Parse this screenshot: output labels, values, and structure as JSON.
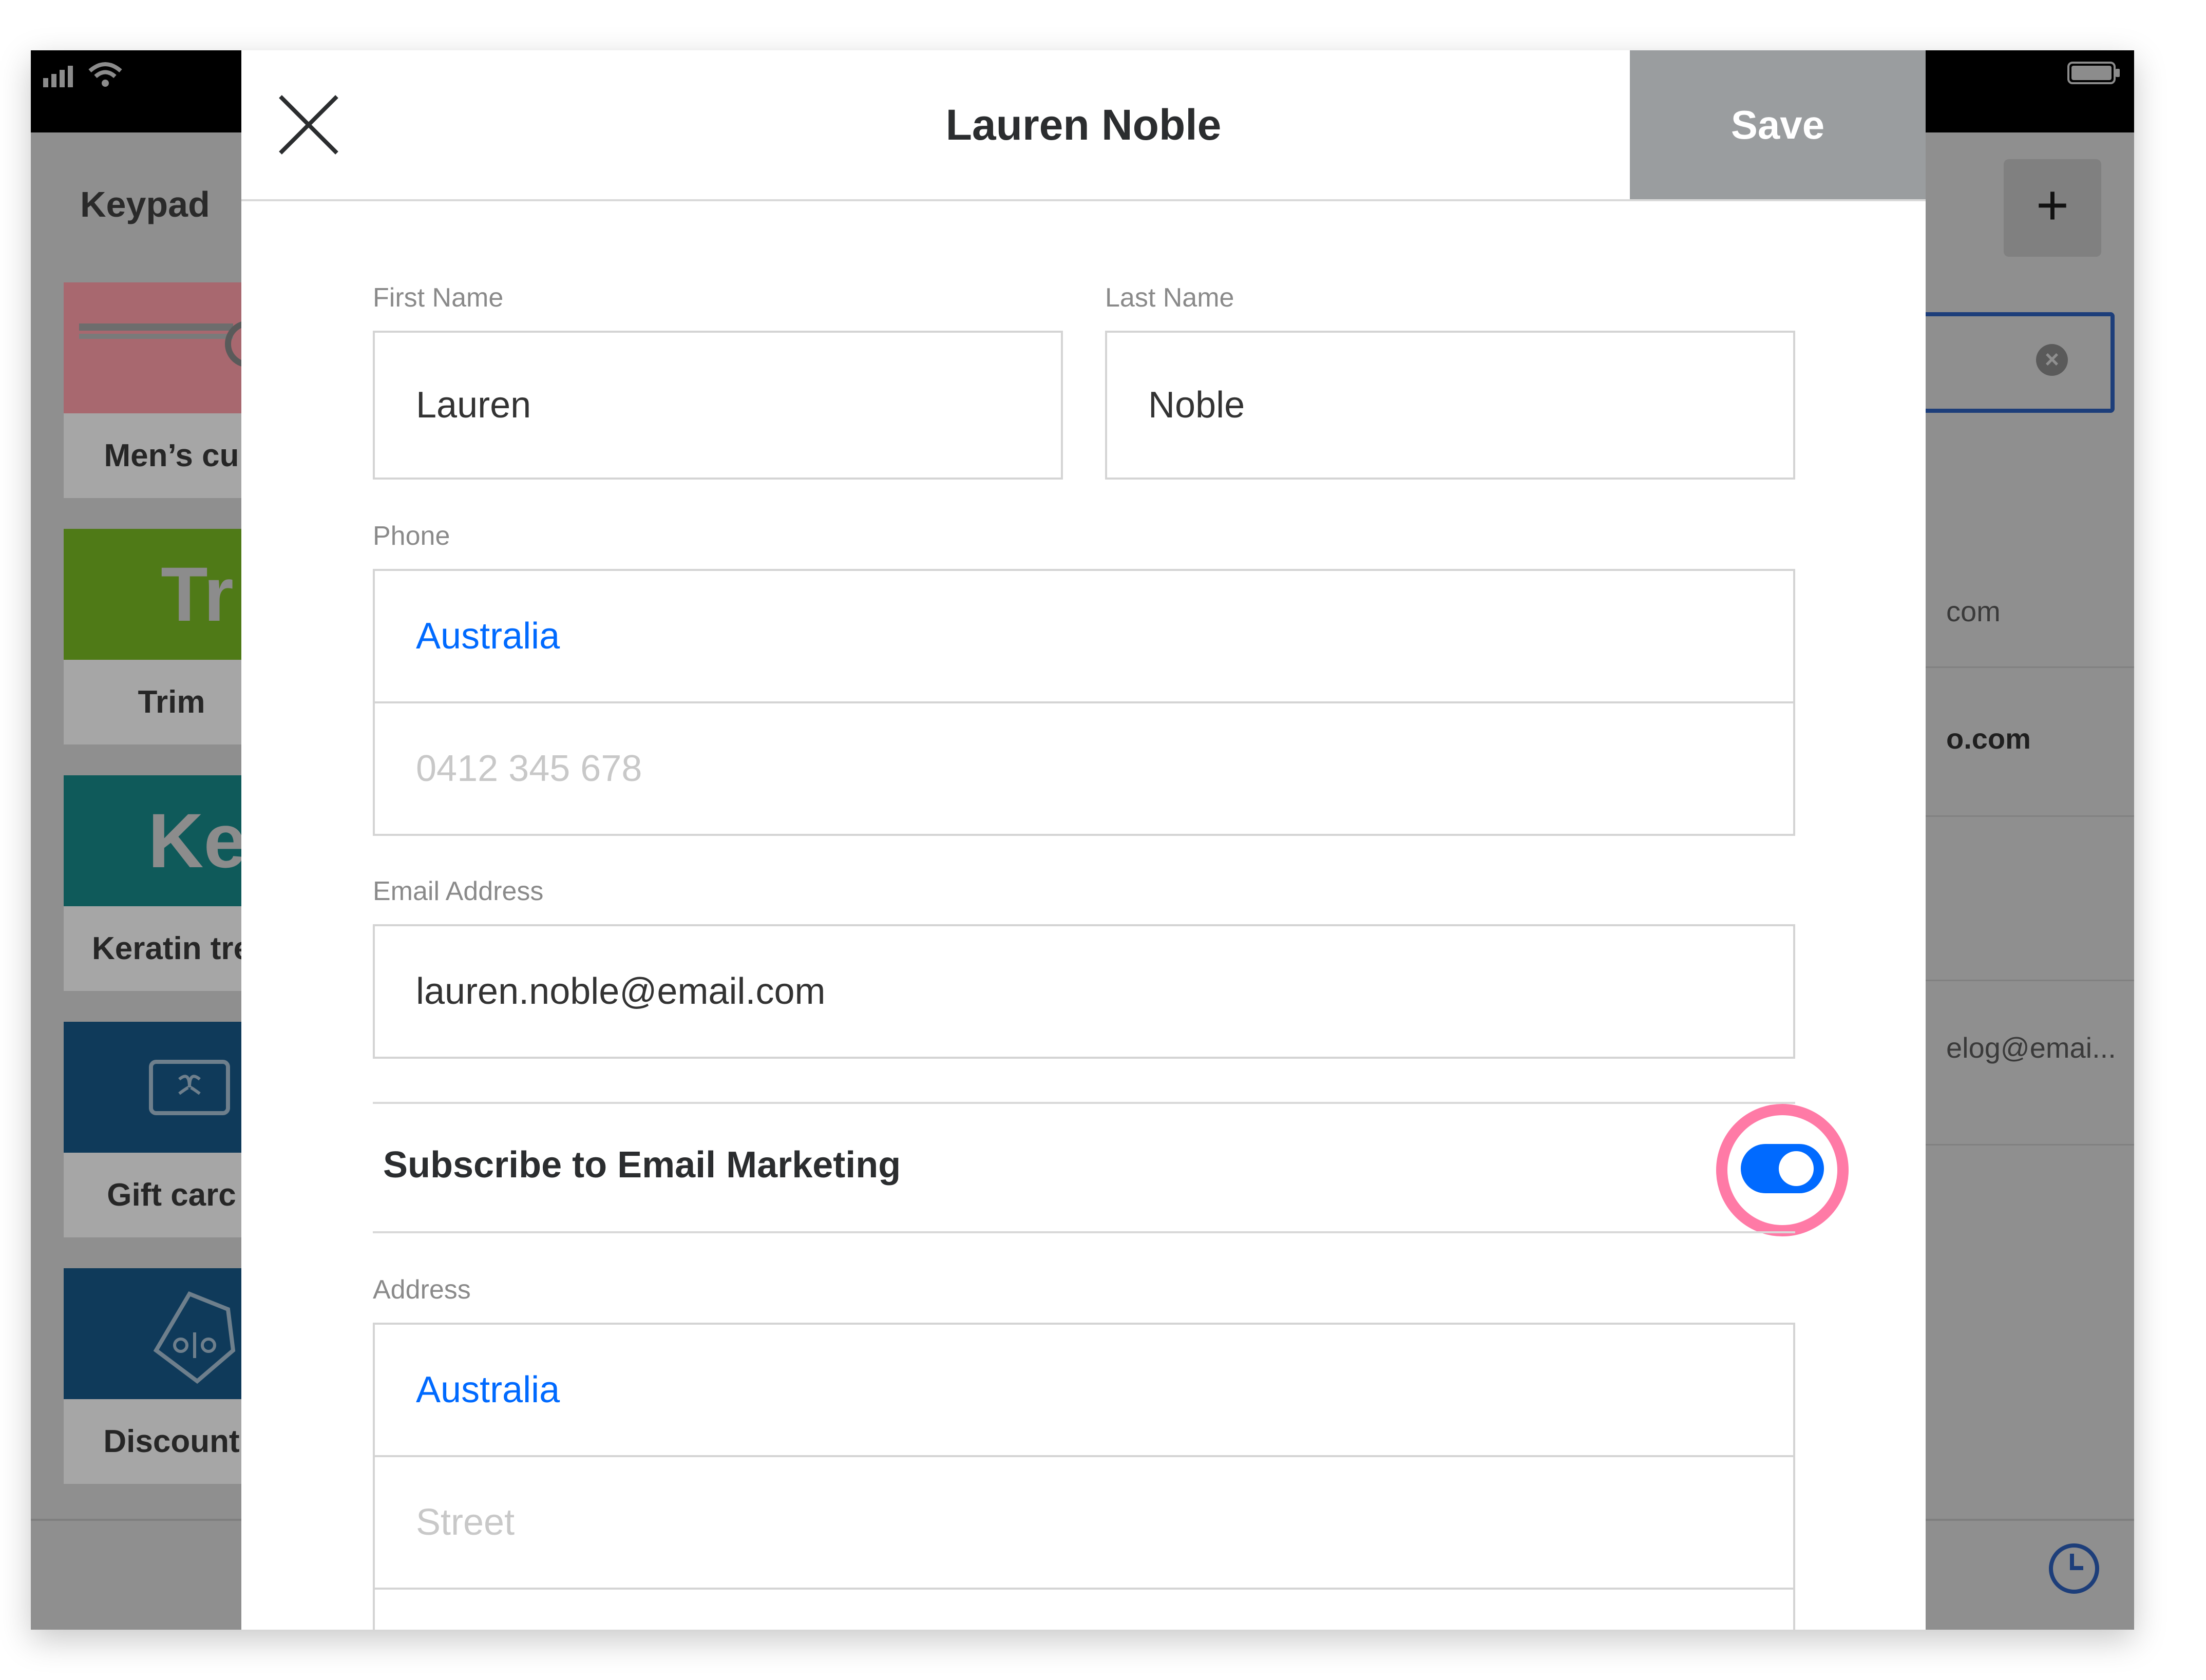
{
  "background_app": {
    "section_title": "Keypad",
    "tiles": [
      {
        "label": "Men’s cu",
        "abbr": "",
        "color": "#c4737f"
      },
      {
        "label": "Trim",
        "abbr": "Tr",
        "color": "#4f7a17"
      },
      {
        "label": "Keratin tre",
        "abbr": "Ke",
        "color": "#0f5a5a"
      },
      {
        "label": "Gift carc",
        "abbr": "",
        "color": "#0f3a5a"
      },
      {
        "label": "Discount",
        "abbr": "",
        "color": "#0f3a5a"
      }
    ],
    "list_fragments": [
      "com",
      "o.com",
      "elog@emai..."
    ]
  },
  "modal": {
    "title": "Lauren Noble",
    "save_label": "Save",
    "fields": {
      "first_name": {
        "label": "First Name",
        "value": "Lauren"
      },
      "last_name": {
        "label": "Last Name",
        "value": "Noble"
      },
      "phone": {
        "label": "Phone",
        "country": "Australia",
        "placeholder": "0412 345 678"
      },
      "email": {
        "label": "Email Address",
        "value": "lauren.noble@email.com"
      },
      "address": {
        "label": "Address",
        "country": "Australia",
        "street_placeholder": "Street"
      }
    },
    "subscribe": {
      "label": "Subscribe to Email Marketing",
      "enabled": true
    }
  },
  "colors": {
    "accent_blue": "#006aff",
    "highlight_pink": "#ff7aa6",
    "save_disabled": "#9a9d9f"
  },
  "icons": [
    "signal-icon",
    "wifi-icon",
    "battery-icon",
    "close-icon",
    "plus-icon",
    "clear-icon",
    "clock-icon",
    "gift-card-icon",
    "discount-tag-icon"
  ]
}
